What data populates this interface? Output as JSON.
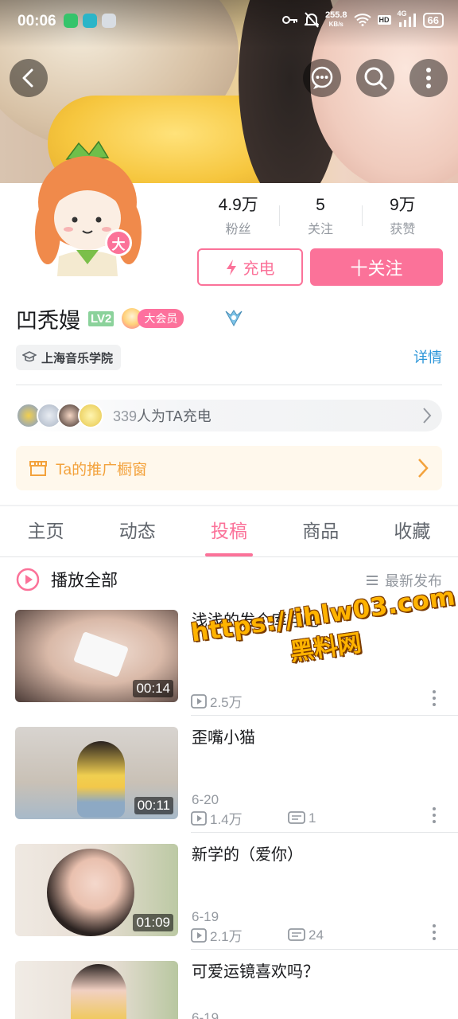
{
  "status_bar": {
    "time": "00:06",
    "net_speed_value": "255.8",
    "net_speed_unit": "KB/s",
    "hd": "HD",
    "network": "4G",
    "battery": "66"
  },
  "profile": {
    "avatar_badge": "大",
    "stats": [
      {
        "value": "4.9万",
        "label": "粉丝"
      },
      {
        "value": "5",
        "label": "关注"
      },
      {
        "value": "9万",
        "label": "获赞"
      }
    ],
    "charge_button": "充电",
    "follow_button": "十关注",
    "name": "凹秃嫚",
    "level": "LV2",
    "vip_label": "大会员",
    "school": "上海音乐学院",
    "details_link": "详情",
    "charge_count": "339",
    "charge_text": "人为TA充电",
    "shop_text": "Ta的推广橱窗"
  },
  "tabs": [
    "主页",
    "动态",
    "投稿",
    "商品",
    "收藏"
  ],
  "active_tab": "投稿",
  "list_header": {
    "play_all": "播放全部",
    "sort": "最新发布"
  },
  "videos": [
    {
      "title": "浅浅的发个库存吧",
      "duration": "00:14",
      "date": "",
      "views": "2.5万",
      "comments": ""
    },
    {
      "title": "歪嘴小猫",
      "duration": "00:11",
      "date": "6-20",
      "views": "1.4万",
      "comments": "1"
    },
    {
      "title": "新学的（爱你）",
      "duration": "01:09",
      "date": "6-19",
      "views": "2.1万",
      "comments": "24"
    },
    {
      "title": "可爱运镜喜欢吗？",
      "duration": "",
      "date": "6-19",
      "views": "",
      "comments": ""
    }
  ],
  "watermark": {
    "url": "https://ihlw03.com",
    "name": "黑料网"
  },
  "colors": {
    "accent": "#fb7299",
    "link": "#2a95d8",
    "shop": "#f3a23c",
    "watermark": "#ffb300"
  }
}
